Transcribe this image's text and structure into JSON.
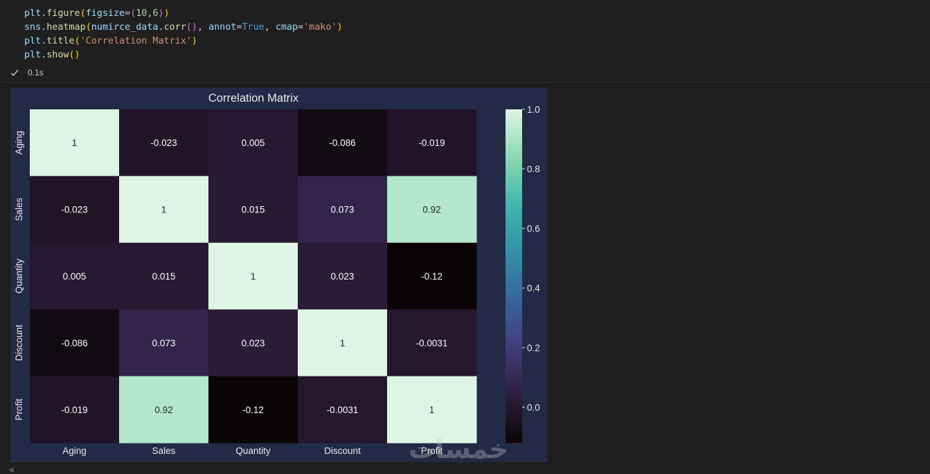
{
  "code": {
    "lines": [
      [
        {
          "t": "plt",
          "c": "tok-var"
        },
        {
          "t": ".",
          "c": "tok-p"
        },
        {
          "t": "figure",
          "c": "tok-fn"
        },
        {
          "t": "(",
          "c": "tok-b1"
        },
        {
          "t": "figsize",
          "c": "tok-var"
        },
        {
          "t": "=",
          "c": "tok-p"
        },
        {
          "t": "(",
          "c": "tok-b2"
        },
        {
          "t": "10",
          "c": "tok-num"
        },
        {
          "t": ",",
          "c": "tok-p"
        },
        {
          "t": "6",
          "c": "tok-num"
        },
        {
          "t": ")",
          "c": "tok-b2"
        },
        {
          "t": ")",
          "c": "tok-b1"
        }
      ],
      [
        {
          "t": "sns",
          "c": "tok-var"
        },
        {
          "t": ".",
          "c": "tok-p"
        },
        {
          "t": "heatmap",
          "c": "tok-fn"
        },
        {
          "t": "(",
          "c": "tok-b1"
        },
        {
          "t": "numirce_data",
          "c": "tok-var"
        },
        {
          "t": ".",
          "c": "tok-p"
        },
        {
          "t": "corr",
          "c": "tok-fn"
        },
        {
          "t": "()",
          "c": "tok-b2"
        },
        {
          "t": ", ",
          "c": "tok-p"
        },
        {
          "t": "annot",
          "c": "tok-var"
        },
        {
          "t": "=",
          "c": "tok-p"
        },
        {
          "t": "True",
          "c": "tok-kw"
        },
        {
          "t": ", ",
          "c": "tok-p"
        },
        {
          "t": "cmap",
          "c": "tok-var"
        },
        {
          "t": "=",
          "c": "tok-p"
        },
        {
          "t": "'mako'",
          "c": "tok-str"
        },
        {
          "t": ")",
          "c": "tok-b1"
        }
      ],
      [
        {
          "t": "plt",
          "c": "tok-var"
        },
        {
          "t": ".",
          "c": "tok-p"
        },
        {
          "t": "title",
          "c": "tok-fn"
        },
        {
          "t": "(",
          "c": "tok-b1"
        },
        {
          "t": "'Correlation Matrix'",
          "c": "tok-str"
        },
        {
          "t": ")",
          "c": "tok-b1"
        }
      ],
      [
        {
          "t": "plt",
          "c": "tok-var"
        },
        {
          "t": ".",
          "c": "tok-p"
        },
        {
          "t": "show",
          "c": "tok-fn"
        },
        {
          "t": "()",
          "c": "tok-b1"
        }
      ]
    ]
  },
  "status": {
    "icon": "check-icon",
    "duration": "0.1s"
  },
  "watermark": "خمسات",
  "chart_data": {
    "type": "heatmap",
    "title": "Correlation Matrix",
    "xlabel": "",
    "ylabel": "",
    "x_categories": [
      "Aging",
      "Sales",
      "Quantity",
      "Discount",
      "Profit"
    ],
    "y_categories": [
      "Aging",
      "Sales",
      "Quantity",
      "Discount",
      "Profit"
    ],
    "values": [
      [
        1,
        -0.023,
        0.005,
        -0.086,
        -0.019
      ],
      [
        -0.023,
        1,
        0.015,
        0.073,
        0.92
      ],
      [
        0.005,
        0.015,
        1,
        0.023,
        -0.12
      ],
      [
        -0.086,
        0.073,
        0.023,
        1,
        -0.0031
      ],
      [
        -0.019,
        0.92,
        -0.12,
        -0.0031,
        1
      ]
    ],
    "annotations": [
      [
        "1",
        "-0.023",
        "0.005",
        "-0.086",
        "-0.019"
      ],
      [
        "-0.023",
        "1",
        "0.015",
        "0.073",
        "0.92"
      ],
      [
        "0.005",
        "0.015",
        "1",
        "0.023",
        "-0.12"
      ],
      [
        "-0.086",
        "0.073",
        "0.023",
        "1",
        "-0.0031"
      ],
      [
        "-0.019",
        "0.92",
        "-0.12",
        "-0.0031",
        "1"
      ]
    ],
    "colormap": "mako",
    "vmin": -0.12,
    "vmax": 1.0,
    "colorbar_ticks": [
      0.0,
      0.2,
      0.4,
      0.6,
      0.8,
      1.0
    ],
    "colorbar_tick_labels": [
      "0.0",
      "0.2",
      "0.4",
      "0.6",
      "0.8",
      "1.0"
    ],
    "colors": {
      "figure_bg": "#232a46",
      "text": "#eaeaea",
      "mako_stops": [
        "#0b0405",
        "#2e1e3c",
        "#413d7b",
        "#37659e",
        "#348fa7",
        "#40b7ad",
        "#8bdab2",
        "#def5e5"
      ]
    }
  }
}
